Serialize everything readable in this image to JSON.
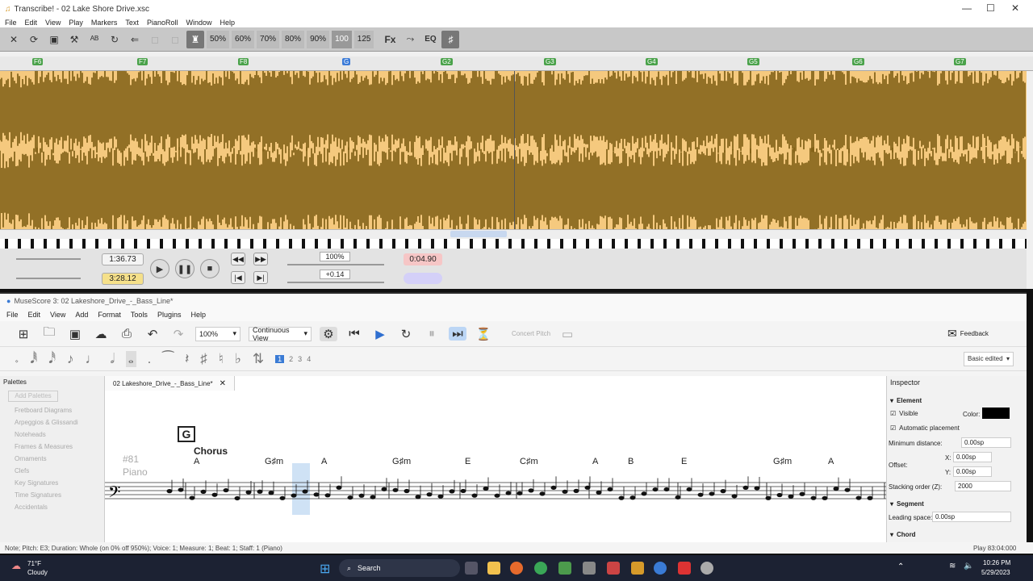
{
  "transcribe": {
    "title": "Transcribe! - 02 Lake Shore Drive.xsc",
    "menu": [
      "File",
      "Edit",
      "View",
      "Play",
      "Markers",
      "Text",
      "PianoRoll",
      "Window",
      "Help"
    ],
    "speeds": [
      "50%",
      "60%",
      "70%",
      "80%",
      "90%",
      "100",
      "125"
    ],
    "fx_label": "Fx",
    "eq_label": "EQ",
    "markers": [
      {
        "label": "F6",
        "kind": "section"
      },
      {
        "label": "F7",
        "kind": "section"
      },
      {
        "label": "F8",
        "kind": "section"
      },
      {
        "label": "G",
        "kind": "current"
      },
      {
        "label": "G2",
        "kind": "section"
      },
      {
        "label": "G3",
        "kind": "section"
      },
      {
        "label": "G4",
        "kind": "section"
      },
      {
        "label": "G5",
        "kind": "section"
      },
      {
        "label": "G6",
        "kind": "section"
      },
      {
        "label": "G7",
        "kind": "section"
      }
    ],
    "position_time": "1:36.73",
    "total_time": "3:28.12",
    "speed_readout": "100%",
    "transpose_readout": "+0.14",
    "loop_time": "0:04.90",
    "waveform_color": "#7a5a10",
    "waveform_bg": "#f5c97e"
  },
  "musescore": {
    "title": "MuseScore 3: 02 Lakeshore_Drive_-_Bass_Line*",
    "menu": [
      "File",
      "Edit",
      "View",
      "Add",
      "Format",
      "Tools",
      "Plugins",
      "Help"
    ],
    "zoom": "100%",
    "view_mode": "Continuous View",
    "concert_pitch": "Concert Pitch",
    "feedback": "Feedback",
    "workspace": "Basic edited",
    "voices": [
      "1",
      "2",
      "3",
      "4"
    ],
    "palettes_header": "Palettes",
    "add_palettes": "Add Palettes",
    "palettes": [
      "Fretboard Diagrams",
      "Arpeggios & Glissandi",
      "Noteheads",
      "Frames & Measures",
      "Ornaments",
      "Clefs",
      "Key Signatures",
      "Time Signatures",
      "Accidentals"
    ],
    "tab_label": "02 Lakeshore_Drive_-_Bass_Line*",
    "rehearsal_mark": "G",
    "section_text": "Chorus",
    "measure_number": "#81",
    "instrument": "Piano",
    "chords": [
      "A",
      "G♯m",
      "A",
      "G♯m",
      "E",
      "C♯m",
      "A",
      "B",
      "E",
      "G♯m",
      "A"
    ],
    "inspector": {
      "title": "Inspector",
      "element_header": "Element",
      "visible_label": "Visible",
      "color_label": "Color:",
      "auto_placement": "Automatic placement",
      "min_distance_label": "Minimum distance:",
      "min_distance": "0.00sp",
      "offset_label": "Offset:",
      "offset_x_label": "X:",
      "offset_x": "0.00sp",
      "offset_y_label": "Y:",
      "offset_y": "0.00sp",
      "stacking_label": "Stacking order (Z):",
      "stacking": "2000",
      "segment_header": "Segment",
      "leading_label": "Leading space:",
      "leading": "0.00sp",
      "chord_header": "Chord"
    },
    "status": "Note; Pitch: E3; Duration: Whole (on 0% off 950%); Voice: 1;  Measure: 1; Beat: 1; Staff: 1 (Piano)",
    "status_right": "Play  83:04:000"
  },
  "taskbar": {
    "weather_temp": "71°F",
    "weather_desc": "Cloudy",
    "search": "Search",
    "time": "10:26 PM",
    "date": "5/29/2023"
  }
}
